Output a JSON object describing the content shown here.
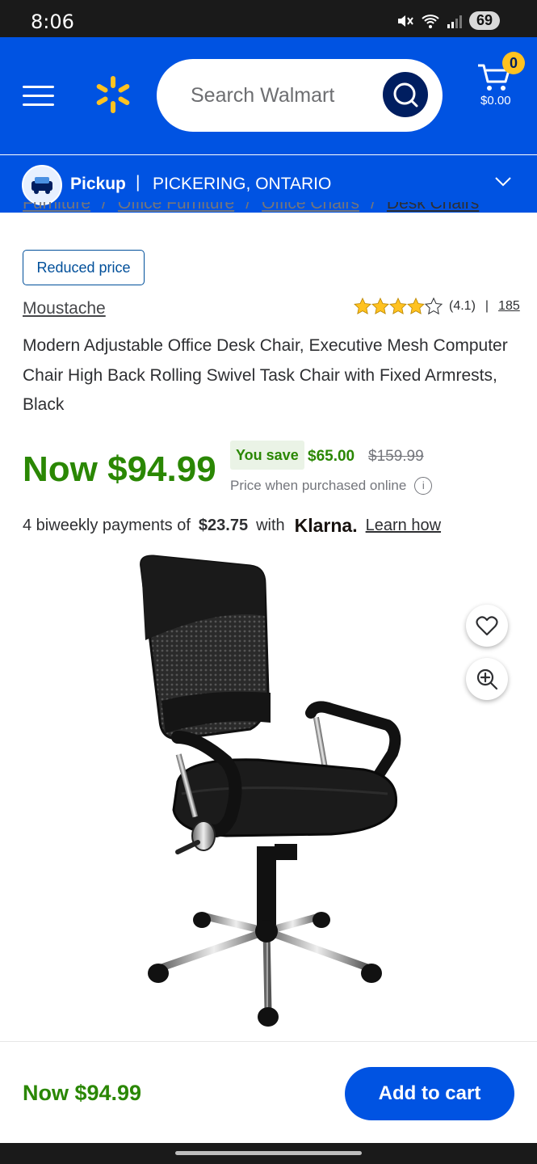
{
  "status_bar": {
    "time": "8:06",
    "battery": "69"
  },
  "header": {
    "search_placeholder": "Search Walmart",
    "cart": {
      "count": "0",
      "total": "$0.00"
    }
  },
  "pickup": {
    "label": "Pickup",
    "separator": "|",
    "location": "PICKERING, ONTARIO"
  },
  "breadcrumb": [
    "Furniture",
    "/",
    "Office Furniture",
    "/",
    "Office Chairs",
    "/",
    "Desk Chairs"
  ],
  "badge": "Reduced price",
  "brand": "Moustache",
  "rating": {
    "value": 4.1,
    "label": "(4.1)",
    "separator": "|",
    "count": "185"
  },
  "product_title": "Modern Adjustable Office Desk Chair, Executive Mesh Computer Chair High Back Rolling Swivel Task Chair with Fixed Armrests, Black",
  "pricing": {
    "current": "Now $94.99",
    "you_save_label": "You save",
    "save_amount": "$65.00",
    "was_price": "$159.99",
    "online_note": "Price when purchased online",
    "info_icon": "i"
  },
  "klarna": {
    "prefix": "4 biweekly payments of",
    "amount": "$23.75",
    "with": "with",
    "logo": "Klarna.",
    "learn": "Learn how"
  },
  "bottom_bar": {
    "price": "Now $94.99",
    "add_to_cart": "Add to cart"
  },
  "colors": {
    "brand_blue": "#0053e2",
    "price_green": "#2a8703",
    "spark_yellow": "#ffc220",
    "navy": "#001e60"
  }
}
